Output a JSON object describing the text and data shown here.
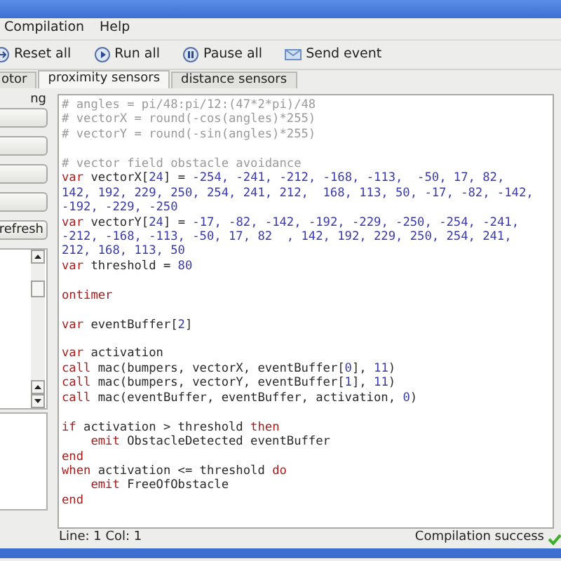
{
  "menu": [
    {
      "label": "Compilation"
    },
    {
      "label": "Help"
    }
  ],
  "toolbar": [
    {
      "label": "Reset all",
      "kind": "reset"
    },
    {
      "label": "Run all",
      "kind": "run"
    },
    {
      "label": "Pause all",
      "kind": "pause"
    },
    {
      "label": "Send event",
      "kind": "mail"
    }
  ],
  "tabs": [
    {
      "label": "otor",
      "selected": false
    },
    {
      "label": "proximity sensors",
      "selected": true
    },
    {
      "label": "distance sensors",
      "selected": false
    }
  ],
  "left_panel": {
    "label": "ng",
    "refresh_button": "refresh"
  },
  "editor": {
    "lines": [
      {
        "segments": [
          {
            "kind": "comment",
            "text": "# angles = pi/48:pi/12:(47*2*pi)/48"
          }
        ]
      },
      {
        "segments": [
          {
            "kind": "comment",
            "text": "# vectorX = round(-cos(angles)*255)"
          }
        ]
      },
      {
        "segments": [
          {
            "kind": "comment",
            "text": "# vectorY = round(-sin(angles)*255)"
          }
        ]
      },
      {
        "kind": "blank"
      },
      {
        "segments": [
          {
            "kind": "comment",
            "text": "# vector field obstacle avoidance"
          }
        ]
      },
      {
        "segments": [
          {
            "kind": "keyword",
            "text": "var"
          },
          {
            "kind": "plain",
            "text": " vectorX["
          },
          {
            "kind": "number",
            "text": "24"
          },
          {
            "kind": "plain",
            "text": "] = "
          },
          {
            "kind": "number",
            "text": "-254, -241, -212, -168, -113,  -50, 17, 82,"
          }
        ]
      },
      {
        "segments": [
          {
            "kind": "number",
            "text": "142, 192, 229, 250, 254, 241, 212,  168, 113, 50, -17, -82, -142,"
          }
        ]
      },
      {
        "segments": [
          {
            "kind": "number",
            "text": "-192, -229, -250"
          }
        ]
      },
      {
        "segments": [
          {
            "kind": "keyword",
            "text": "var"
          },
          {
            "kind": "plain",
            "text": " vectorY["
          },
          {
            "kind": "number",
            "text": "24"
          },
          {
            "kind": "plain",
            "text": "] = "
          },
          {
            "kind": "number",
            "text": "-17, -82, -142, -192, -229, -250, -254, -241,"
          }
        ]
      },
      {
        "segments": [
          {
            "kind": "number",
            "text": "-212, -168, -113, -50, 17, 82  , 142, 192, 229, 250, 254, 241,"
          }
        ]
      },
      {
        "segments": [
          {
            "kind": "number",
            "text": "212, 168, 113, 50"
          }
        ]
      },
      {
        "segments": [
          {
            "kind": "keyword",
            "text": "var"
          },
          {
            "kind": "plain",
            "text": " threshold = "
          },
          {
            "kind": "number",
            "text": "80"
          }
        ]
      },
      {
        "kind": "blank"
      },
      {
        "segments": [
          {
            "kind": "keyword",
            "text": "ontimer"
          }
        ]
      },
      {
        "kind": "blank"
      },
      {
        "segments": [
          {
            "kind": "keyword",
            "text": "var"
          },
          {
            "kind": "plain",
            "text": " eventBuffer["
          },
          {
            "kind": "number",
            "text": "2"
          },
          {
            "kind": "plain",
            "text": "]"
          }
        ]
      },
      {
        "kind": "blank"
      },
      {
        "segments": [
          {
            "kind": "keyword",
            "text": "var"
          },
          {
            "kind": "plain",
            "text": " activation"
          }
        ]
      },
      {
        "segments": [
          {
            "kind": "keyword",
            "text": "call"
          },
          {
            "kind": "plain",
            "text": " mac(bumpers, vectorX, eventBuffer["
          },
          {
            "kind": "number",
            "text": "0"
          },
          {
            "kind": "plain",
            "text": "], "
          },
          {
            "kind": "number",
            "text": "11"
          },
          {
            "kind": "plain",
            "text": ")"
          }
        ]
      },
      {
        "segments": [
          {
            "kind": "keyword",
            "text": "call"
          },
          {
            "kind": "plain",
            "text": " mac(bumpers, vectorY, eventBuffer["
          },
          {
            "kind": "number",
            "text": "1"
          },
          {
            "kind": "plain",
            "text": "], "
          },
          {
            "kind": "number",
            "text": "11"
          },
          {
            "kind": "plain",
            "text": ")"
          }
        ]
      },
      {
        "segments": [
          {
            "kind": "keyword",
            "text": "call"
          },
          {
            "kind": "plain",
            "text": " mac(eventBuffer, eventBuffer, activation, "
          },
          {
            "kind": "number",
            "text": "0"
          },
          {
            "kind": "plain",
            "text": ")"
          }
        ]
      },
      {
        "kind": "blank"
      },
      {
        "segments": [
          {
            "kind": "keyword",
            "text": "if"
          },
          {
            "kind": "plain",
            "text": " activation > threshold "
          },
          {
            "kind": "keyword",
            "text": "then"
          }
        ]
      },
      {
        "kind": "code",
        "indented": true,
        "segments": [
          {
            "kind": "keyword",
            "text": "emit"
          },
          {
            "kind": "plain",
            "text": " ObstacleDetected eventBuffer"
          }
        ]
      },
      {
        "segments": [
          {
            "kind": "keyword",
            "text": "end"
          }
        ]
      },
      {
        "segments": [
          {
            "kind": "keyword",
            "text": "when"
          },
          {
            "kind": "plain",
            "text": " activation <= threshold "
          },
          {
            "kind": "keyword",
            "text": "do"
          }
        ]
      },
      {
        "kind": "code",
        "indented": true,
        "segments": [
          {
            "kind": "keyword",
            "text": "emit"
          },
          {
            "kind": "plain",
            "text": " FreeOfObstacle"
          }
        ]
      },
      {
        "segments": [
          {
            "kind": "keyword",
            "text": "end"
          }
        ]
      }
    ]
  },
  "status_bar": {
    "position": "Line: 1 Col: 1",
    "compilation": "Compilation success"
  }
}
